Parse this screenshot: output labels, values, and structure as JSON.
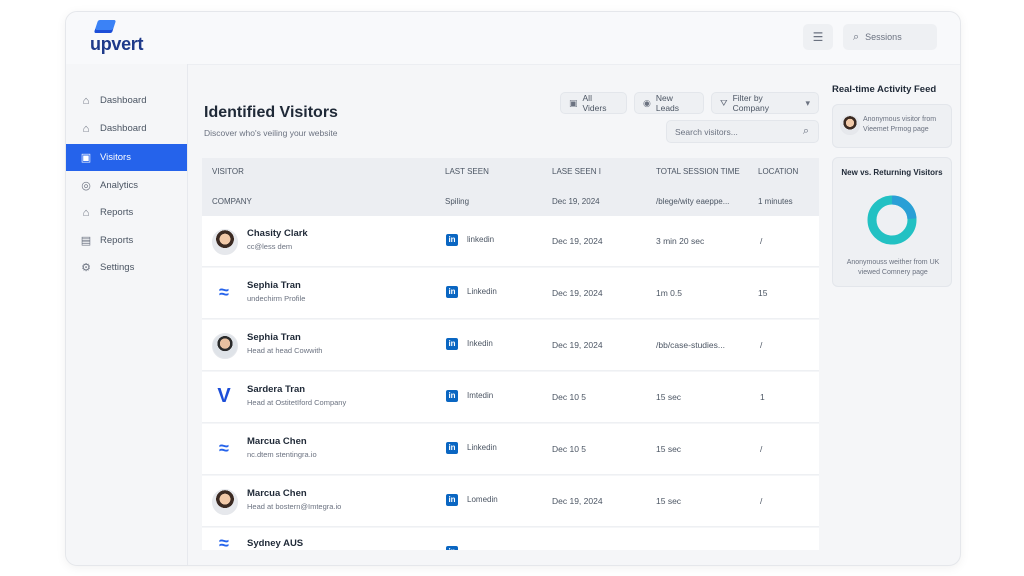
{
  "app": {
    "logo_text": "upvert"
  },
  "topbar": {
    "search_label": "Sessions"
  },
  "sidebar": {
    "items": [
      {
        "label": "Dashboard",
        "icon": "home-icon",
        "active": false
      },
      {
        "label": "Dashboard",
        "icon": "home-icon",
        "active": false
      },
      {
        "label": "Visitors",
        "icon": "users-icon",
        "active": true
      },
      {
        "label": "Analytics",
        "icon": "analytics-icon",
        "active": false
      },
      {
        "label": "Reports",
        "icon": "home-icon",
        "active": false
      },
      {
        "label": "Reports",
        "icon": "report-icon",
        "active": false
      },
      {
        "label": "Settings",
        "icon": "gear-icon",
        "active": false
      }
    ]
  },
  "main": {
    "title": "Identified Visitors",
    "subtitle": "Discover who's veiling your website",
    "filters": {
      "all_visitors": "All Viders",
      "new_leads": "New Leads",
      "filter_company": "Filter by Company"
    },
    "search": {
      "placeholder": "Search visitors..."
    },
    "table": {
      "headers_row1": [
        "VISITOR",
        "LAST SEEN",
        "LASE SEEN I",
        "TOTAL SESSION TIME",
        "LOCATION"
      ],
      "headers_row2": [
        "COMPANY",
        "Spiling",
        "Dec 19, 2024",
        "/blege/wity eaeppe...",
        "1 minutes"
      ],
      "rows": [
        {
          "name": "Chasity Clark",
          "sub": "cc@less dem",
          "avatar": "female",
          "source": "linkedin",
          "date": "Dec 19, 2024",
          "session": "3 min 20 sec",
          "location": "/"
        },
        {
          "name": "Sephia Tran",
          "sub": "undechirm Profile",
          "avatar": "wave",
          "source": "Linkedin",
          "date": "Dec 19, 2024",
          "session": "1m 0.5",
          "location": "15"
        },
        {
          "name": "Sephia Tran",
          "sub": "Head at head Cowwith",
          "avatar": "male",
          "source": "Inkedin",
          "date": "Dec 19, 2024",
          "session": "/bb/case-studies...",
          "location": "/"
        },
        {
          "name": "Sardera Tran",
          "sub": "Head at OstitetIford Company",
          "avatar": "v",
          "source": "Imtedin",
          "date": "Dec 10 5",
          "session": "15 sec",
          "location": "1"
        },
        {
          "name": "Marcua Chen",
          "sub": "nc.dtem stentingra.io",
          "avatar": "wave",
          "source": "Linkedin",
          "date": "Dec 10 5",
          "session": "15 sec",
          "location": "/"
        },
        {
          "name": "Marcua Chen",
          "sub": "Head at bostern@Imtegra.io",
          "avatar": "female",
          "source": "Lomedin",
          "date": "Dec 19, 2024",
          "session": "15 sec",
          "location": "/"
        },
        {
          "name": "Sydney AUS",
          "sub": "",
          "avatar": "wave",
          "source": "",
          "date": "",
          "session": "",
          "location": ""
        }
      ]
    }
  },
  "activity": {
    "title": "Real-time Activity Feed",
    "item_text": "Anonymous visitor from Vieemet Prmog page",
    "donut_title": "New vs. Returning Visitors",
    "donut_caption": "Anonymouss weither from UK viewed Comnery page",
    "donut_colors": [
      "#22c1c3",
      "#2a9fd6"
    ]
  }
}
